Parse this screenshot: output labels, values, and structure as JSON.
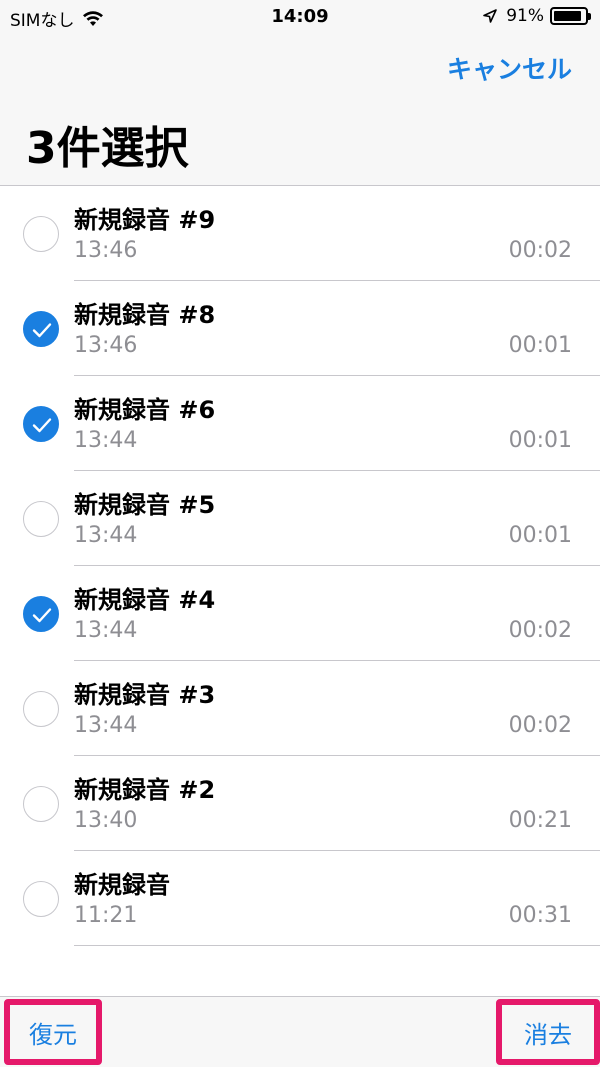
{
  "status_bar": {
    "carrier": "SIMなし",
    "time": "14:09",
    "battery": "91%",
    "battery_level": 0.91
  },
  "nav": {
    "cancel_label": "キャンセル",
    "title": "3件選択"
  },
  "recordings": [
    {
      "name": "新規録音 #9",
      "time": "13:46",
      "duration": "00:02",
      "selected": false
    },
    {
      "name": "新規録音 #8",
      "time": "13:46",
      "duration": "00:01",
      "selected": true
    },
    {
      "name": "新規録音 #6",
      "time": "13:44",
      "duration": "00:01",
      "selected": true
    },
    {
      "name": "新規録音 #5",
      "time": "13:44",
      "duration": "00:01",
      "selected": false
    },
    {
      "name": "新規録音 #4",
      "time": "13:44",
      "duration": "00:02",
      "selected": true
    },
    {
      "name": "新規録音 #3",
      "time": "13:44",
      "duration": "00:02",
      "selected": false
    },
    {
      "name": "新規録音 #2",
      "time": "13:40",
      "duration": "00:21",
      "selected": false
    },
    {
      "name": "新規録音",
      "time": "11:21",
      "duration": "00:31",
      "selected": false
    }
  ],
  "toolbar": {
    "recover_label": "復元",
    "delete_label": "消去"
  },
  "colors": {
    "accent": "#1a7fe0",
    "highlight": "#e5196a"
  }
}
